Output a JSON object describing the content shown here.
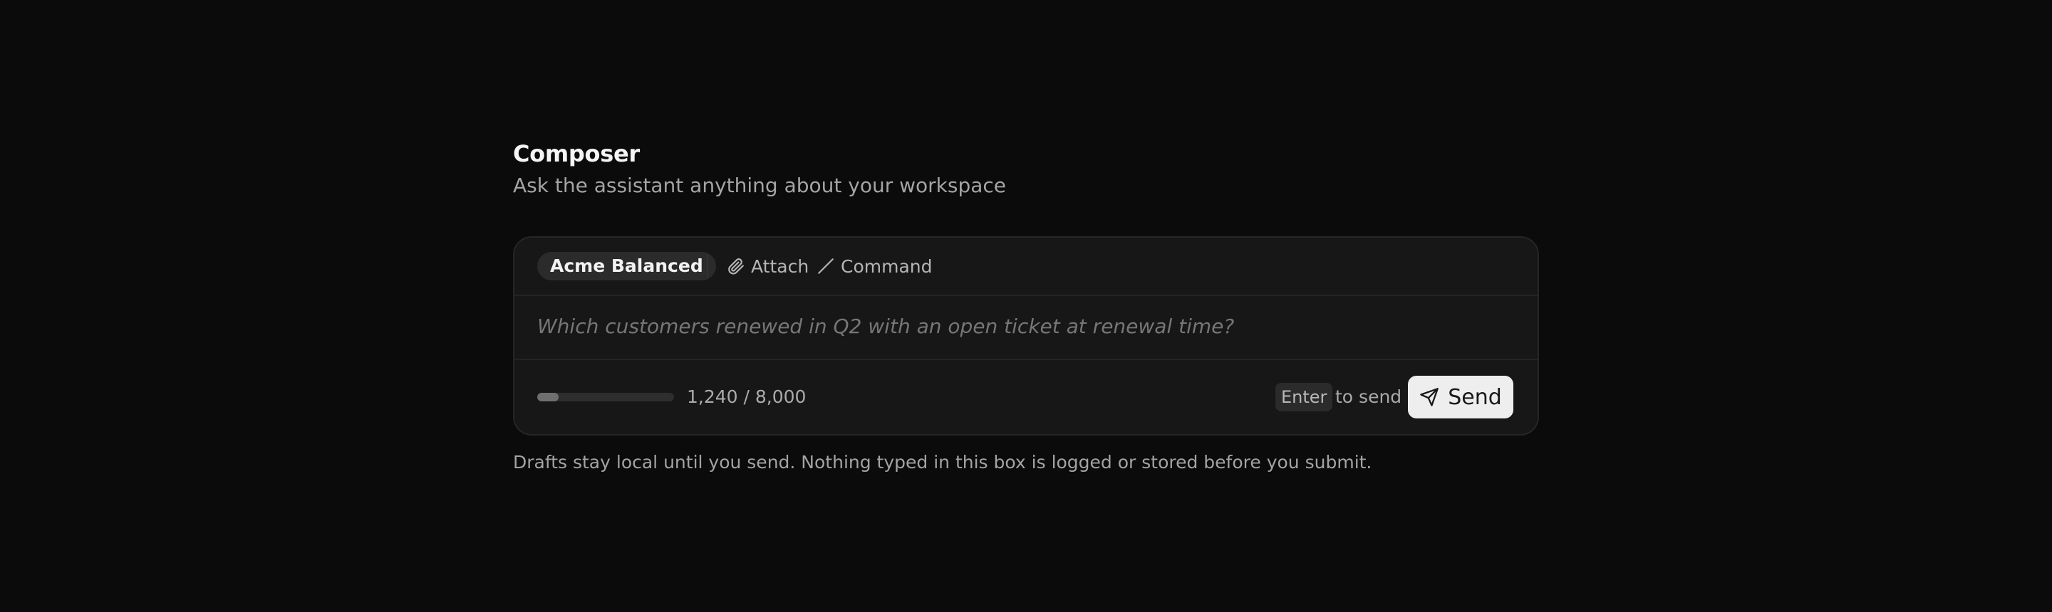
{
  "composer": {
    "title": "Composer",
    "subtitle": "Ask the assistant anything about your workspace"
  },
  "toolbar": {
    "model_label": "Acme Balanced",
    "attach_label": "Attach",
    "attach_icon": "paperclip-icon",
    "command_label": "Command",
    "command_icon": "slash-icon"
  },
  "prompt": {
    "placeholder": "Which customers renewed in Q2 with an open ticket at renewal time?",
    "value": ""
  },
  "footer": {
    "char_count": "1,240 / 8,000",
    "char_used": 1240,
    "char_limit": 8000,
    "enter_key": "Enter",
    "enter_hint": "to send",
    "send_label": "Send",
    "send_icon": "send-icon"
  },
  "note": "Drafts stay local until you send. Nothing typed in this box is logged or stored before you submit.",
  "colors": {
    "background": "#0b0b0b",
    "card": "#171717",
    "send_button": "#eeeeee",
    "pill": "#2b2b2b"
  }
}
